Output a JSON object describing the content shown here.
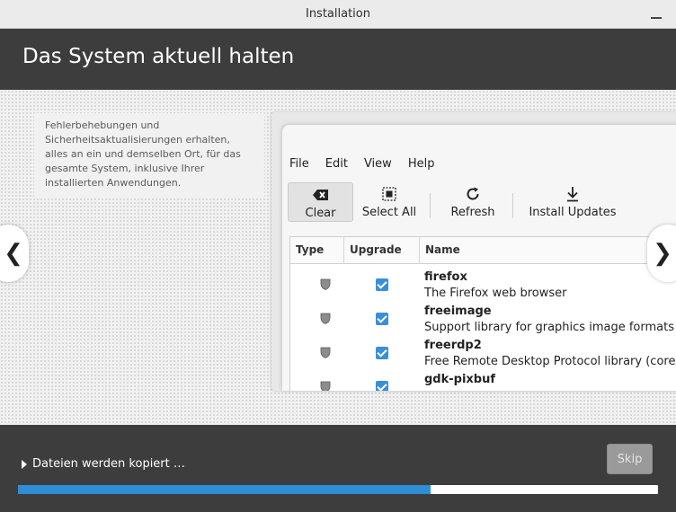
{
  "window": {
    "title": "Installation"
  },
  "header": {
    "heading": "Das System aktuell halten"
  },
  "slide": {
    "description": "Fehlerbehebungen und Sicherheitsaktualisierungen erhalten, alles an ein und demselben Ort, für das gesamte System, inklusive Ihrer installierten Anwendungen.",
    "nav_prev": "❮",
    "nav_next": "❯"
  },
  "screenshot": {
    "menu": [
      "File",
      "Edit",
      "View",
      "Help"
    ],
    "toolbar": {
      "clear": "Clear",
      "select_all": "Select All",
      "refresh": "Refresh",
      "install_updates": "Install Updates"
    },
    "columns": {
      "type": "Type",
      "upgrade": "Upgrade",
      "name": "Name"
    },
    "rows": [
      {
        "name": "firefox",
        "description": "The Firefox web browser",
        "checked": true
      },
      {
        "name": "freeimage",
        "description": "Support library for graphics image formats (libr",
        "checked": true
      },
      {
        "name": "freerdp2",
        "description": "Free Remote Desktop Protocol library (core libr",
        "checked": true
      },
      {
        "name": "gdk-pixbuf",
        "description": "",
        "checked": true
      }
    ]
  },
  "footer": {
    "status": "Dateien werden kopiert …",
    "skip_label": "Skip",
    "progress_percent": 64.5
  },
  "colors": {
    "header_bg": "#3d3d3d",
    "accent": "#2d8ed6",
    "checkbox": "#3a8fd8"
  }
}
